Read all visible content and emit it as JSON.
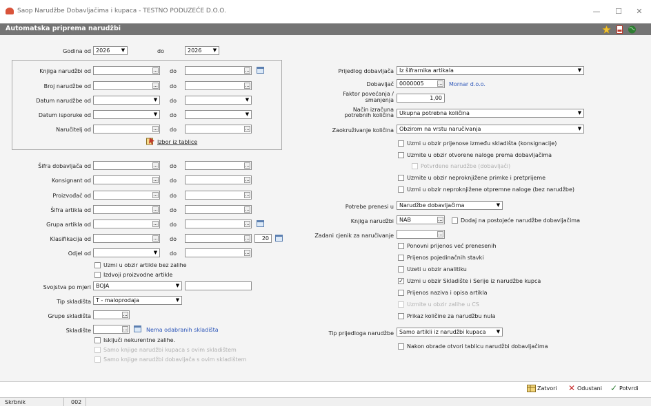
{
  "window": {
    "title": "Saop Narudžbe Dobavljačima i kupaca - TESTNO PODUZEĆE D.O.O.",
    "minimize": "—",
    "maximize": "☐",
    "close": "✕"
  },
  "form": {
    "title": "Automatska priprema narudžbi"
  },
  "left": {
    "godina_od_label": "Godina od",
    "godina_od": "2026",
    "do_label": "do",
    "godina_do": "2026",
    "knjiga_label": "Knjiga narudžbi od",
    "broj_label": "Broj narudžbe od",
    "datum_nar_label": "Datum narudžbe od",
    "datum_isp_label": "Datum isporuke od",
    "narucitelj_label": "Naručitelj od",
    "izbor_label": "Izbor iz tablice",
    "sifra_dob_label": "Šifra dobavljača od",
    "konsignant_label": "Konsignant od",
    "proizvodac_label": "Proizvođač od",
    "sifra_art_label": "Šifra artikla od",
    "grupa_art_label": "Grupa artikla od",
    "klasifikacija_label": "Klasifikacija od",
    "klasifikacija_num": "20",
    "odjel_label": "Odjel od",
    "cb_bez_zalihe": "Uzmi u obzir artikle bez zalihe",
    "cb_izdvoji": "Izdvoji proizvodne artikle",
    "svojstva_label": "Svojstva po mjeri",
    "svojstva_value": "BOJA",
    "tip_skl_label": "Tip skladišta",
    "tip_skl_value": "T - maloprodaja",
    "grupe_skl_label": "Grupe skladišta",
    "skladiste_label": "Skladište",
    "nema_skl": "Nema odabranih skladišta",
    "cb_iskljuci": "Isključi nekurentne zalihe.",
    "cb_samo_kupaca": "Samo knjige narudžbi kupaca s ovim skladištem",
    "cb_samo_dob": "Samo knjige narudžbi dobavljača s ovim skladištem"
  },
  "right": {
    "prijedlog_label": "Prijedlog dobavljača",
    "prijedlog_value": "Iz šifrarnika artikala",
    "dobavljac_label": "Dobavljač",
    "dobavljac_value": "0000005",
    "dobavljac_name": "Mornar d.o.o.",
    "faktor_label1": "Faktor povećanja /",
    "faktor_label2": "smanjenja",
    "faktor_value": "1,00",
    "nacin_label1": "Način izračuna",
    "nacin_label2": "potrebnih količina",
    "nacin_value": "Ukupna potrebna količina",
    "zaokr_label": "Zaokruživanje količina",
    "zaokr_value": "Obzirom na vrstu naručivanja",
    "cb1": "Uzmi u obzir prijenose između skladišta (konsignacije)",
    "cb2": "Uzmite u obzir otvorene naloge prema dobavljačima",
    "cb3": "Potvrđene narudžbe (dobavljači)",
    "cb4": "Uzmite u obzir neproknjižene primke i pretprijeme",
    "cb5": "Uzmi u obzir neproknjižene otpremne naloge (bez narudžbe)",
    "potrebe_label": "Potrebe prenesi u",
    "potrebe_value": "Narudžbe dobavljačima",
    "knjiga_label": "Knjiga narudžbi",
    "knjiga_value": "NAB",
    "cb_dodaj": "Dodaj na postojeće narudžbe dobavljačima",
    "cjenik_label": "Zadani cjenik za naručivanje",
    "cb6": "Ponovni prijenos već prenesenih",
    "cb7": "Prijenos pojedinačnih stavki",
    "cb8": "Uzeti u obzir analitiku",
    "cb9": "Uzmi u obzir Skladište i Serije iz narudžbe kupca",
    "cb10": "Prijenos naziva i opisa artikla",
    "cb11": "Uzmite u obzir zalihe u CS",
    "cb12": "Prikaz količine za narudžbu nula",
    "tip_prij_label": "Tip prijedloga narudžbe",
    "tip_prij_value": "Samo artikli iz narudžbi kupaca",
    "cb13": "Nakon obrade otvori tablicu narudžbi dobavljačima"
  },
  "buttons": {
    "zatvori": "Zatvori",
    "odustani": "Odustani",
    "potvrdi": "Potvrdi"
  },
  "status": {
    "user": "Skrbnik",
    "code": "002"
  },
  "colors": {
    "formbar": "#747474",
    "link": "#2a54b8",
    "panel": "#f4f4f4"
  }
}
